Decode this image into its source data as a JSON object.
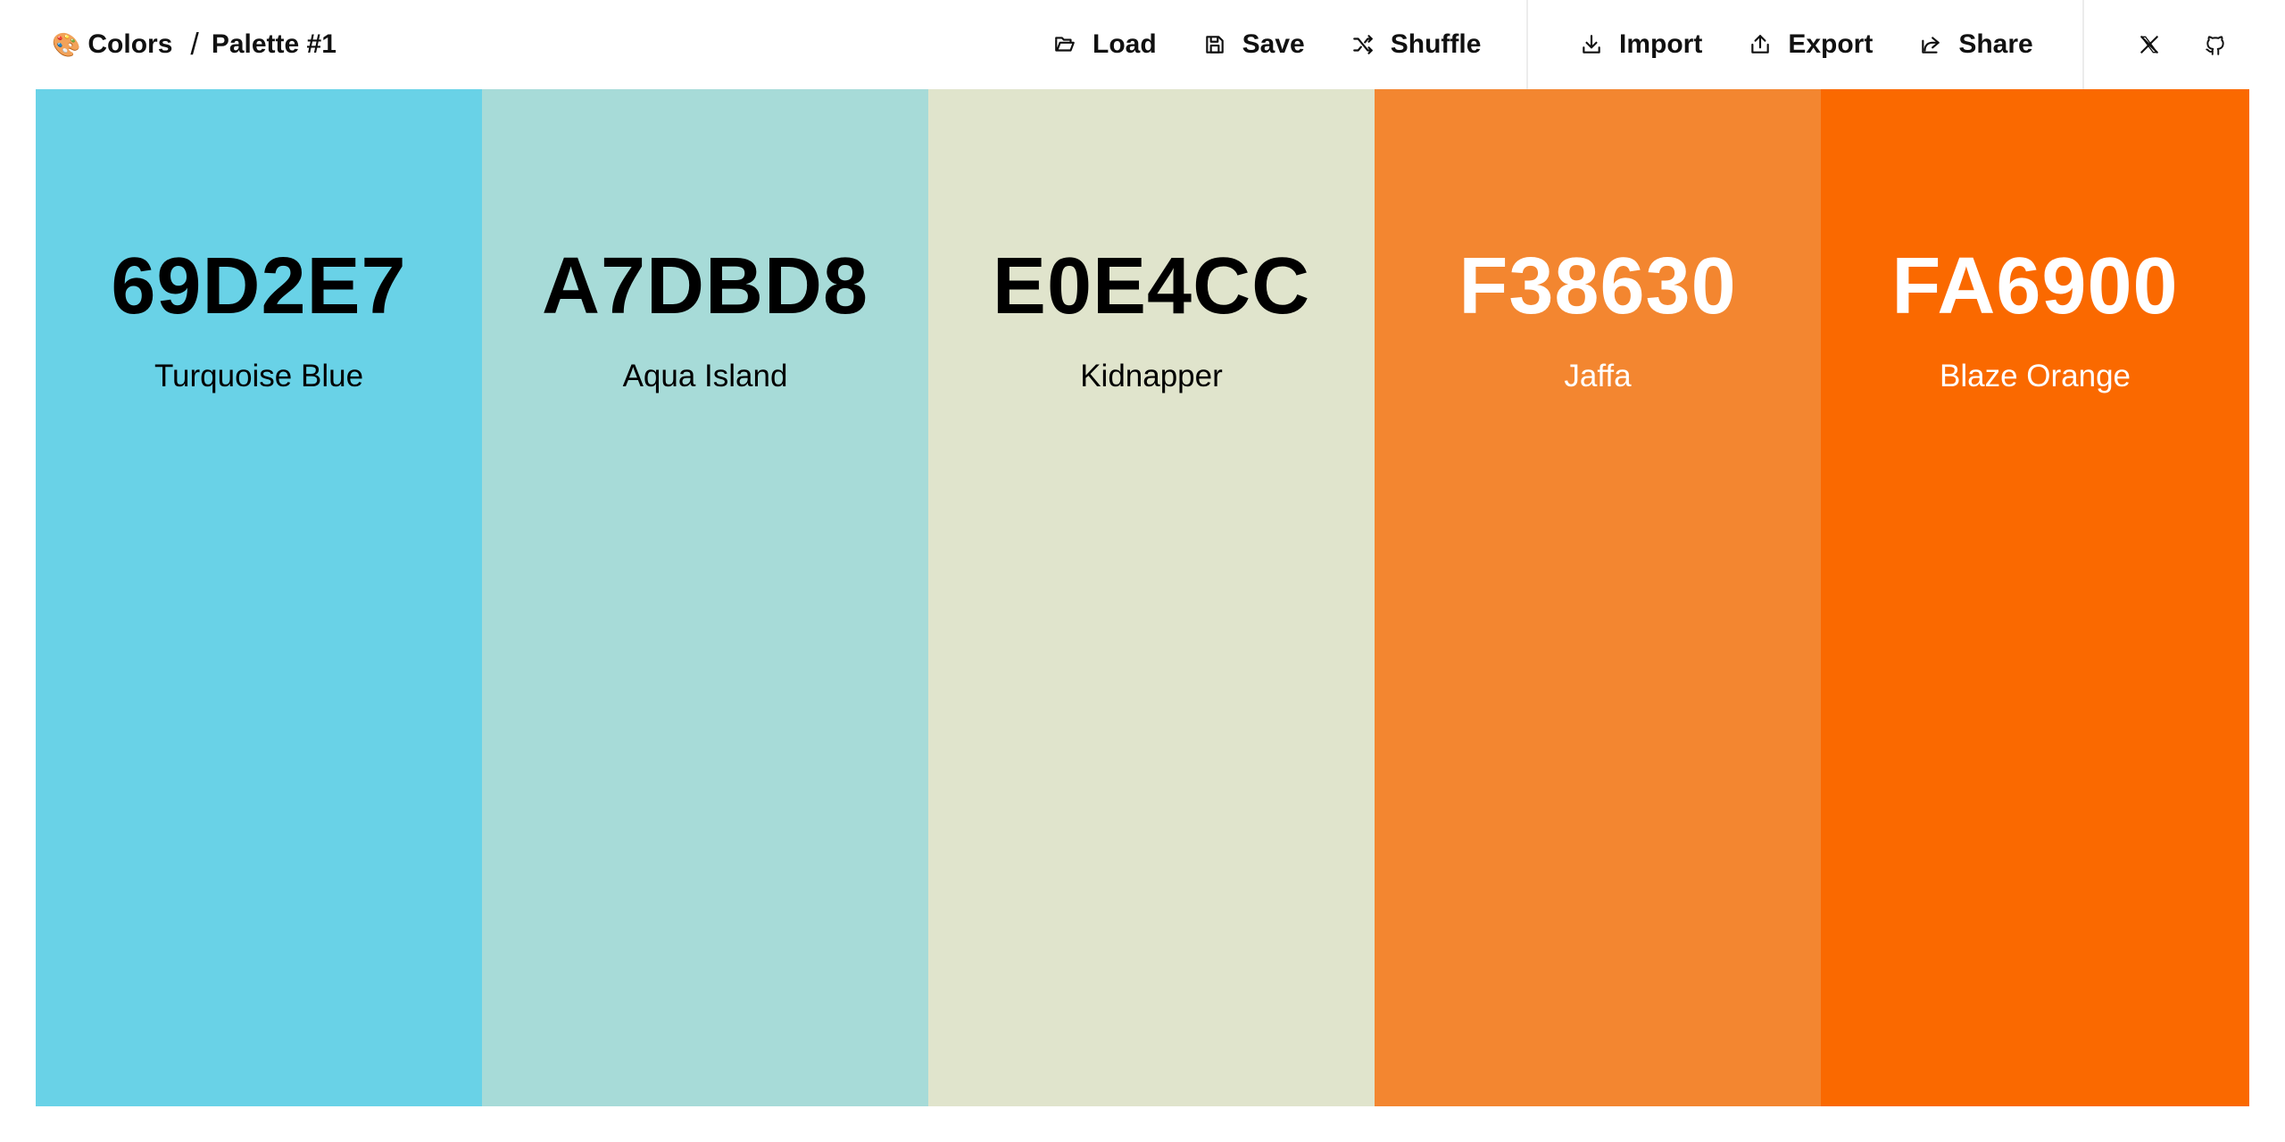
{
  "header": {
    "brand_icon": "🎨",
    "brand": "Colors",
    "separator": "/",
    "palette_name": "Palette #1"
  },
  "toolbar": {
    "load": "Load",
    "save": "Save",
    "shuffle": "Shuffle",
    "import": "Import",
    "export": "Export",
    "share": "Share"
  },
  "social": {
    "x": "x-logo-icon",
    "github": "github-icon"
  },
  "palette": {
    "colors": [
      {
        "hex": "69D2E7",
        "name": "Turquoise Blue",
        "bg": "#69D2E7",
        "fg": "#000000"
      },
      {
        "hex": "A7DBD8",
        "name": "Aqua Island",
        "bg": "#A7DBD8",
        "fg": "#000000"
      },
      {
        "hex": "E0E4CC",
        "name": "Kidnapper",
        "bg": "#E0E4CC",
        "fg": "#000000"
      },
      {
        "hex": "F38630",
        "name": "Jaffa",
        "bg": "#F38630",
        "fg": "#FFFFFF"
      },
      {
        "hex": "FA6900",
        "name": "Blaze Orange",
        "bg": "#FA6900",
        "fg": "#FFFFFF"
      }
    ]
  }
}
